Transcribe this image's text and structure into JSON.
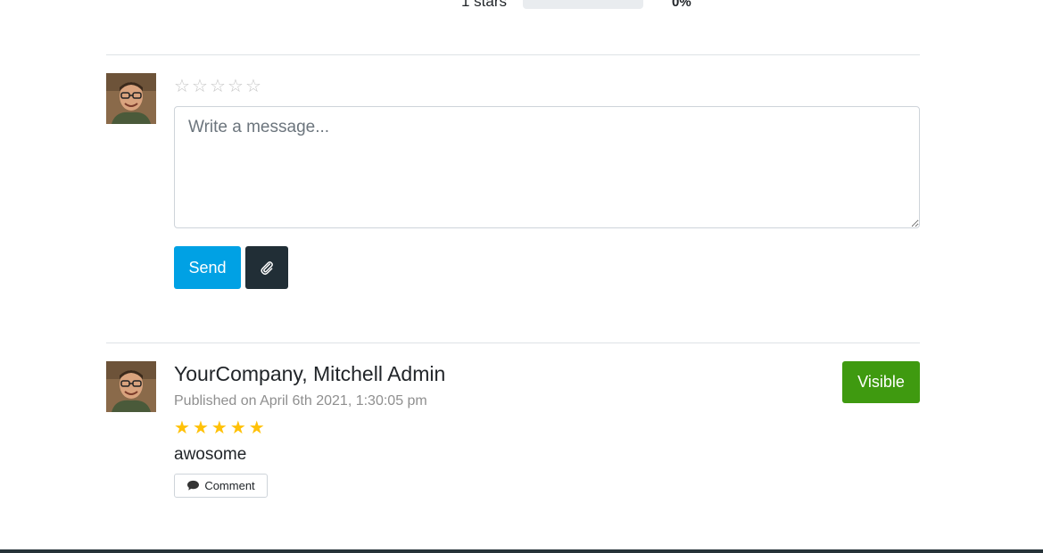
{
  "rating_summary": {
    "label": "1 stars",
    "percent_text": "0%",
    "percent": 0
  },
  "composer": {
    "avatar_icon": "user-avatar-icon",
    "star_icon": "star-outline-icon",
    "stars": [
      "☆",
      "☆",
      "☆",
      "☆",
      "☆"
    ],
    "placeholder": "Write a message...",
    "send_label": "Send",
    "attach_icon": "paperclip-icon"
  },
  "review": {
    "author": "YourCompany, Mitchell Admin",
    "published": "Published on April 6th 2021, 1:30:05 pm",
    "rating": 5,
    "stars": [
      "★",
      "★",
      "★",
      "★",
      "★"
    ],
    "text": "awosome",
    "comment_label": "Comment",
    "comment_icon": "speech-bubble-icon",
    "visibility_label": "Visible"
  },
  "colors": {
    "send_button": "#00a1e4",
    "attach_button": "#212e36",
    "visible_button": "#3f9a10",
    "star_filled": "#ffc107",
    "star_empty": "#c6c6c6"
  }
}
